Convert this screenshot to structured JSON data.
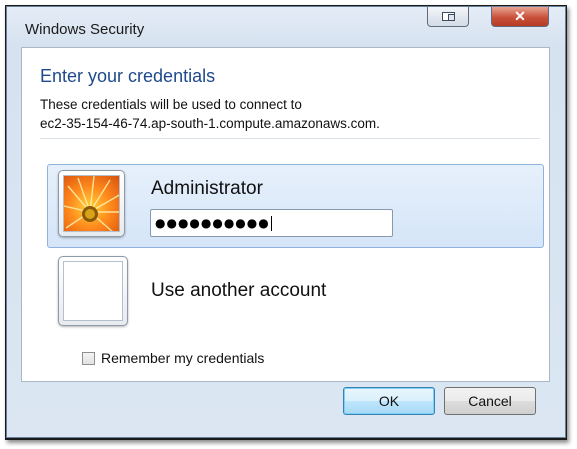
{
  "window": {
    "title": "Windows Security",
    "close_glyph": "✕"
  },
  "dialog": {
    "heading": "Enter your credentials",
    "description_line1": "These credentials will be used to connect to",
    "description_line2": "ec2-35-154-46-74.ap-south-1.compute.amazonaws.com."
  },
  "accounts": [
    {
      "name": "Administrator",
      "avatar": "orange-flower-avatar",
      "selected": true
    },
    {
      "name": "Use another account",
      "avatar": "blank-avatar",
      "selected": false
    }
  ],
  "password": {
    "masked_value": "●●●●●●●●●●"
  },
  "remember": {
    "label": "Remember my credentials",
    "checked": false
  },
  "buttons": {
    "ok": "OK",
    "cancel": "Cancel"
  },
  "colors": {
    "heading": "#1e4a8c",
    "selected_tile": "#d5e5f8",
    "close_button": "#c8513a"
  }
}
